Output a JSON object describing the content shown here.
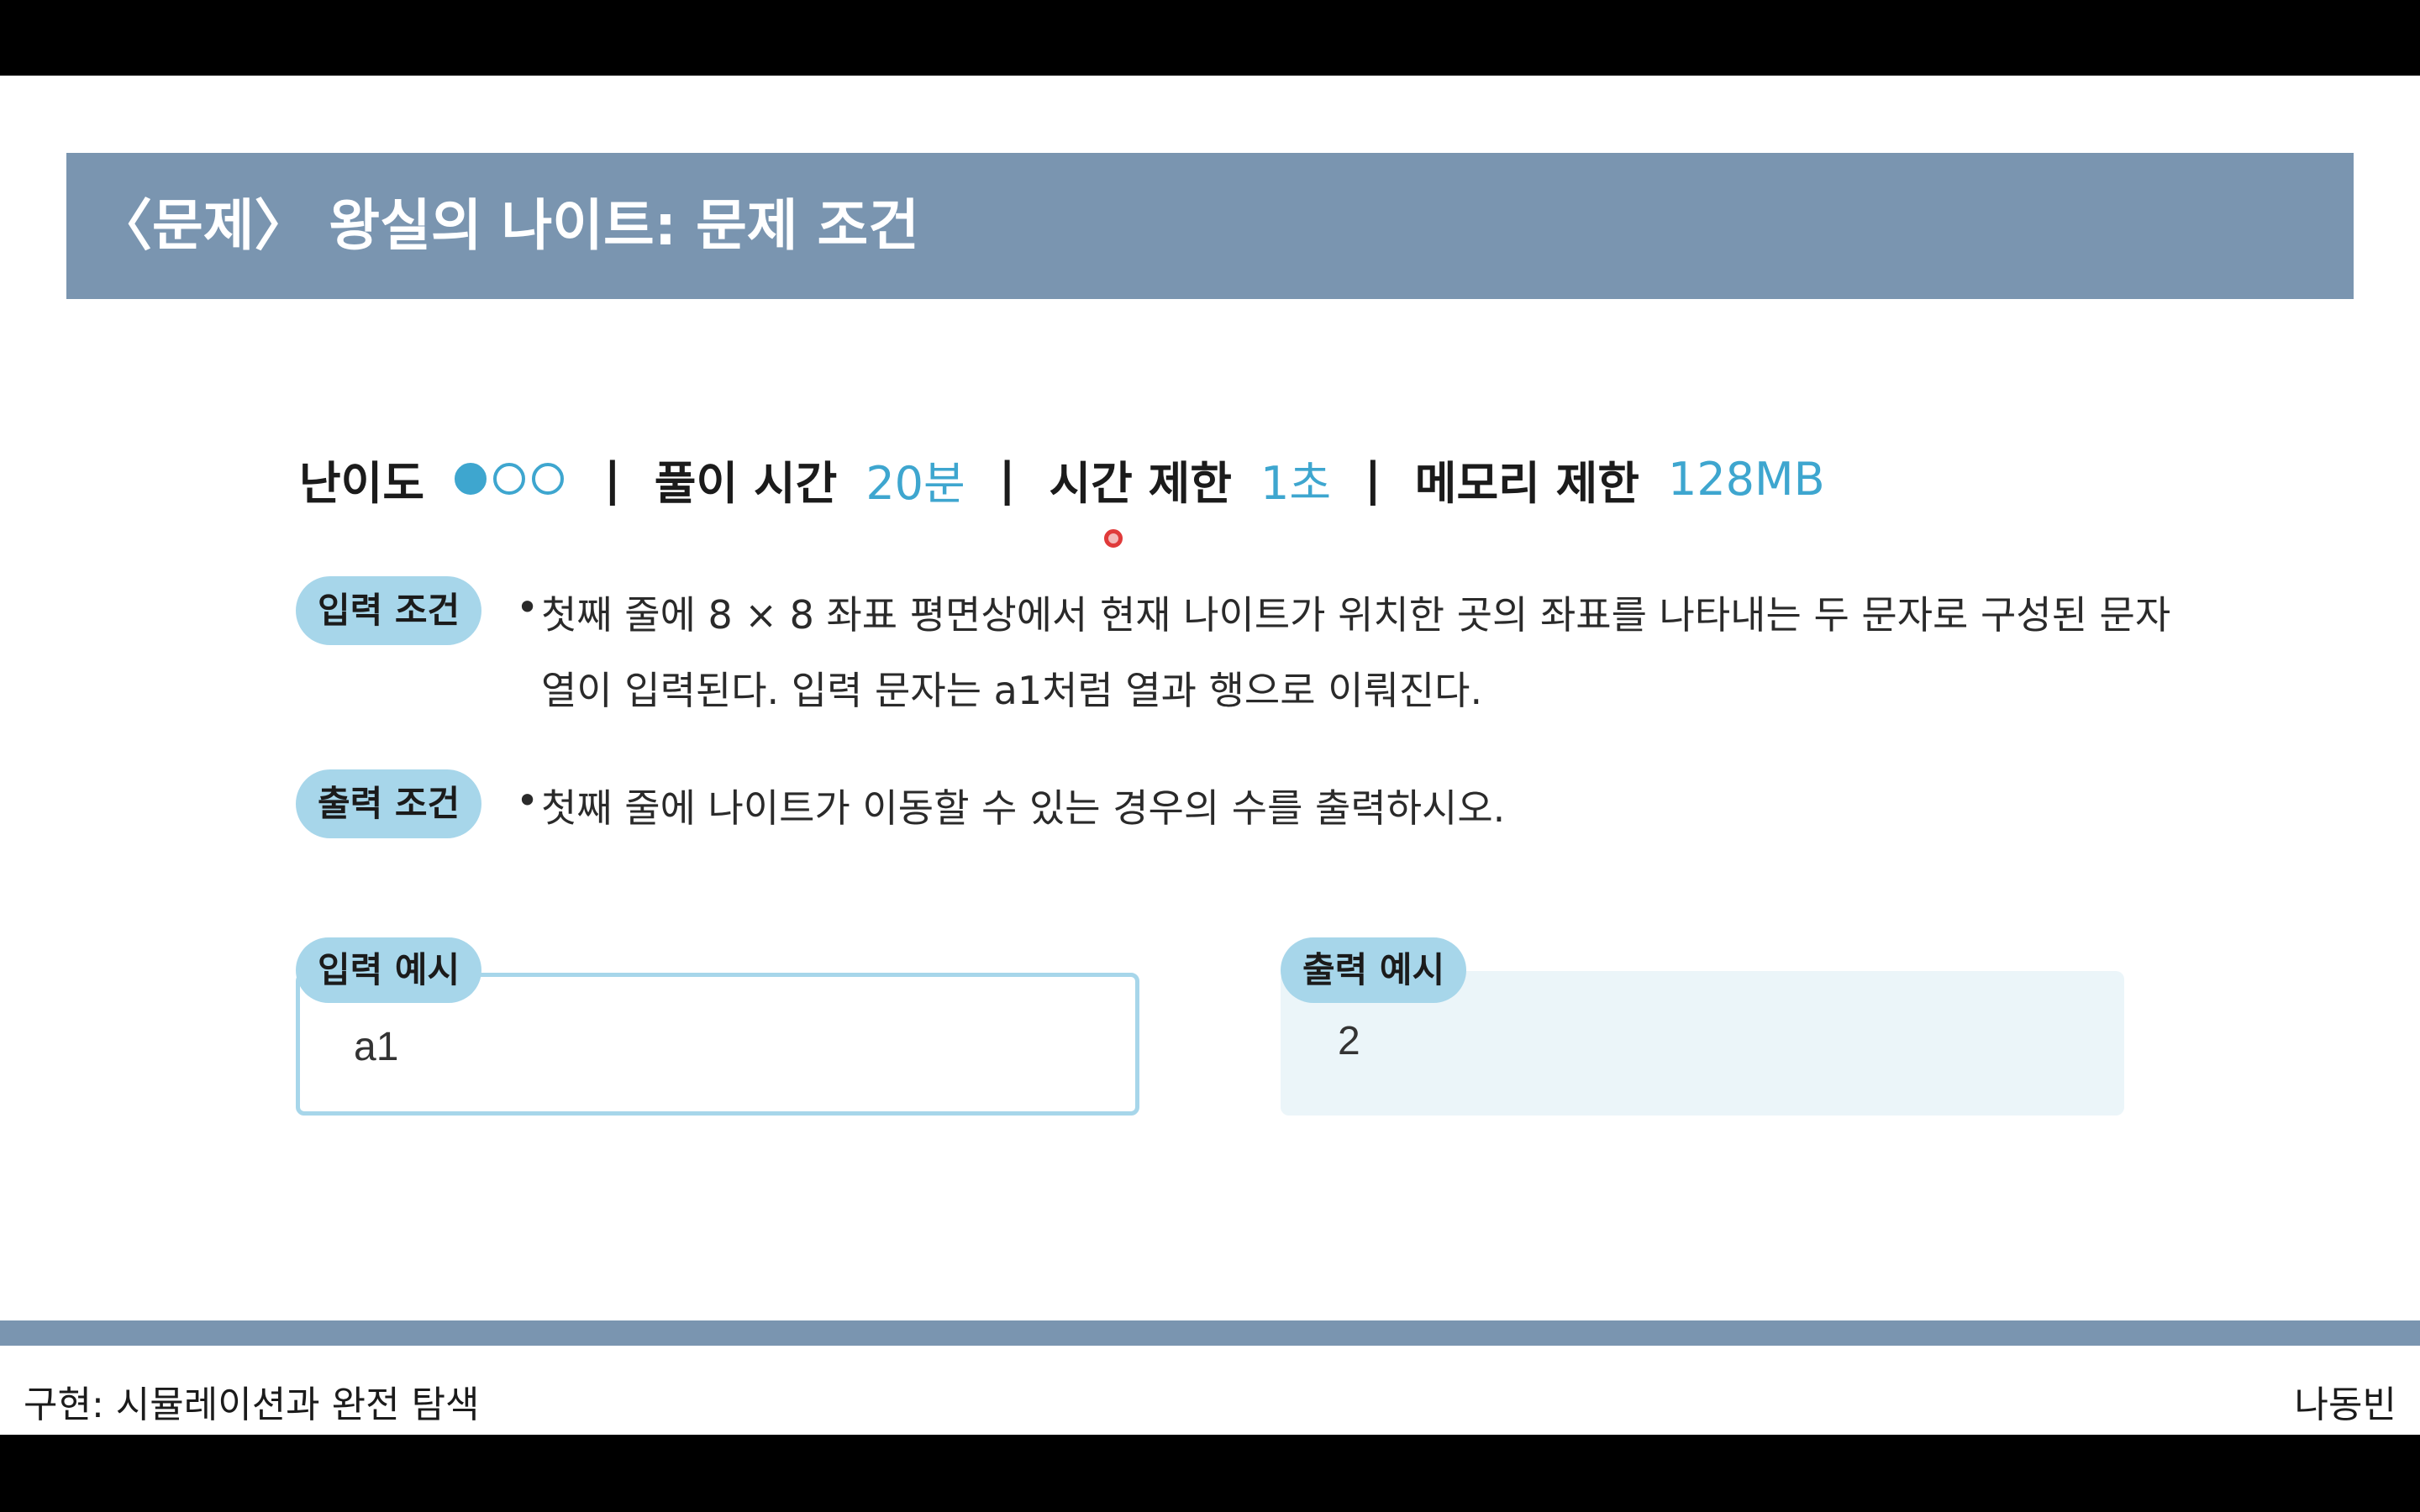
{
  "title": "〈문제〉 왕실의 나이트: 문제 조건",
  "meta": {
    "difficulty_label": "난이도",
    "difficulty_level": 1,
    "difficulty_max": 3,
    "solve_time_label": "풀이 시간",
    "solve_time_value": "20분",
    "time_limit_label": "시간 제한",
    "time_limit_value": "1초",
    "memory_limit_label": "메모리 제한",
    "memory_limit_value": "128MB",
    "separator": "|"
  },
  "input_condition": {
    "label": "입력 조건",
    "bullet": "•",
    "line1": "첫째 줄에 8 × 8 좌표 평면상에서 현재 나이트가 위치한 곳의 좌표를 나타내는 두 문자로 구성된 문자",
    "line2": "열이 입력된다. 입력 문자는 a1처럼 열과 행으로 이뤄진다."
  },
  "output_condition": {
    "label": "출력 조건",
    "bullet": "•",
    "line1": "첫째 줄에 나이트가 이동할 수 있는 경우의 수를 출력하시오."
  },
  "input_example": {
    "label": "입력 예시",
    "value": "a1"
  },
  "output_example": {
    "label": "출력 예시",
    "value": "2"
  },
  "footer": {
    "left": "구현: 시뮬레이션과 완전 탐색",
    "right": "나동빈"
  },
  "colors": {
    "title_bar": "#7a95b0",
    "accent": "#3ea6cf",
    "pill": "#a7d6ea",
    "output_box": "#ebf5f9"
  }
}
